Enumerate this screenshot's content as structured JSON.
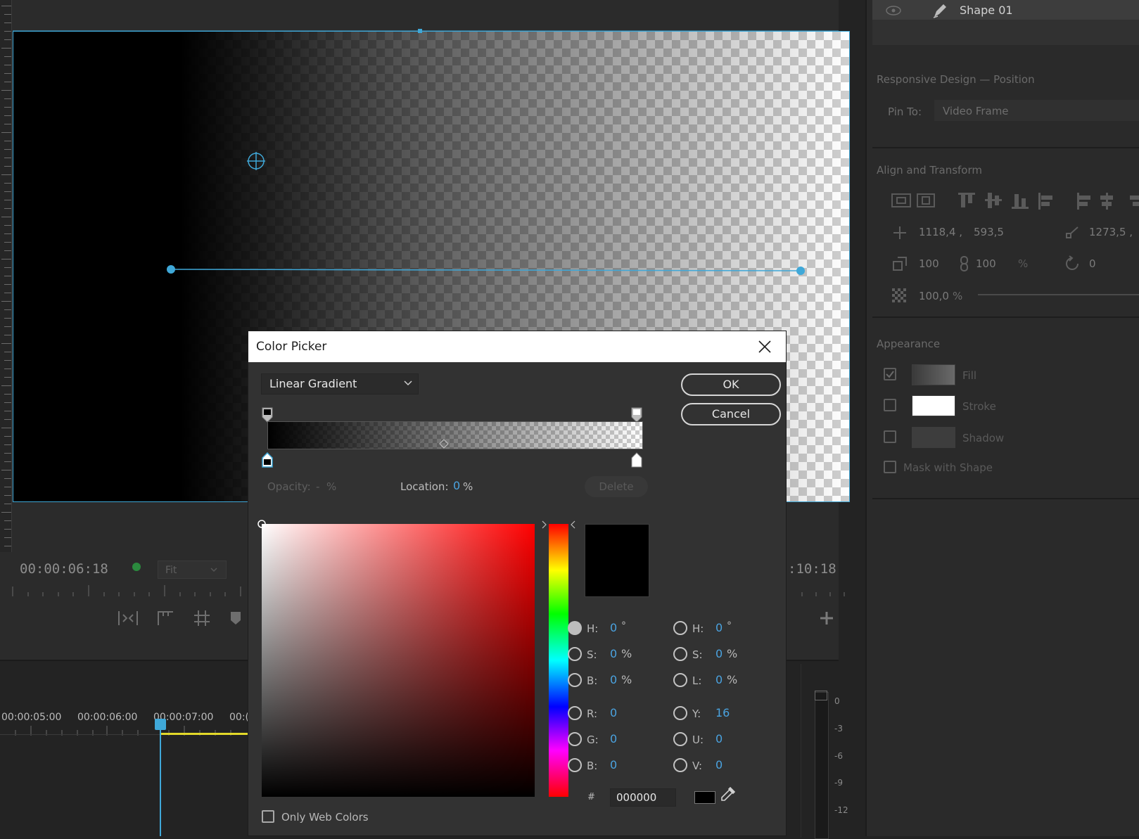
{
  "monitor": {
    "current_time": "00:00:06:18",
    "zoom": "Fit",
    "duration_partial": ":10:18"
  },
  "timeline": {
    "times": [
      "00:00:05:00",
      "00:00:06:00",
      "00:00:07:00",
      "00:("
    ]
  },
  "meter": {
    "labels": [
      "0",
      "-3",
      "-6",
      "-9",
      "-12"
    ]
  },
  "right_panel": {
    "layer_name": "Shape 01",
    "responsive_header": "Responsive Design — Position",
    "pin_to_label": "Pin To:",
    "pin_to_value": "Video Frame",
    "align_header": "Align and Transform",
    "pos_x": "1118,4 ,",
    "pos_y": "593,5",
    "anchor_x": "1273,5 ,",
    "scale_w": "100",
    "scale_h": "100",
    "scale_unit": "%",
    "rotation": "0",
    "opacity": "100,0",
    "opacity_unit": "%",
    "appearance_header": "Appearance",
    "fill_label": "Fill",
    "stroke_label": "Stroke",
    "shadow_label": "Shadow",
    "mask_label": "Mask with Shape"
  },
  "dialog": {
    "title": "Color Picker",
    "gradient_type": "Linear Gradient",
    "ok": "OK",
    "cancel": "Cancel",
    "opacity_label": "Opacity:",
    "opacity_value": "-",
    "opacity_unit": "%",
    "location_label": "Location:",
    "location_value": "0",
    "location_unit": "%",
    "delete": "Delete",
    "hsb": {
      "h_label": "H:",
      "h_value": "0",
      "h_unit": "°",
      "s_label": "S:",
      "s_value": "0",
      "s_unit": "%",
      "b_label": "B:",
      "b_value": "0",
      "b_unit": "%"
    },
    "rgb": {
      "r_label": "R:",
      "r_value": "0",
      "g_label": "G:",
      "g_value": "0",
      "b_label": "B:",
      "b_value": "0"
    },
    "hsl": {
      "h_label": "H:",
      "h_value": "0",
      "h_unit": "°",
      "s_label": "S:",
      "s_value": "0",
      "s_unit": "%",
      "l_label": "L:",
      "l_value": "0",
      "l_unit": "%"
    },
    "yuv": {
      "y_label": "Y:",
      "y_value": "16",
      "u_label": "U:",
      "u_value": "0",
      "v_label": "V:",
      "v_value": "0"
    },
    "hex_label": "#",
    "hex_value": "000000",
    "web_colors_label": "Only Web Colors"
  },
  "colors": {
    "accent": "#3fa8d8",
    "value_blue": "#4aa3e0",
    "work_area": "#e3d92a"
  }
}
